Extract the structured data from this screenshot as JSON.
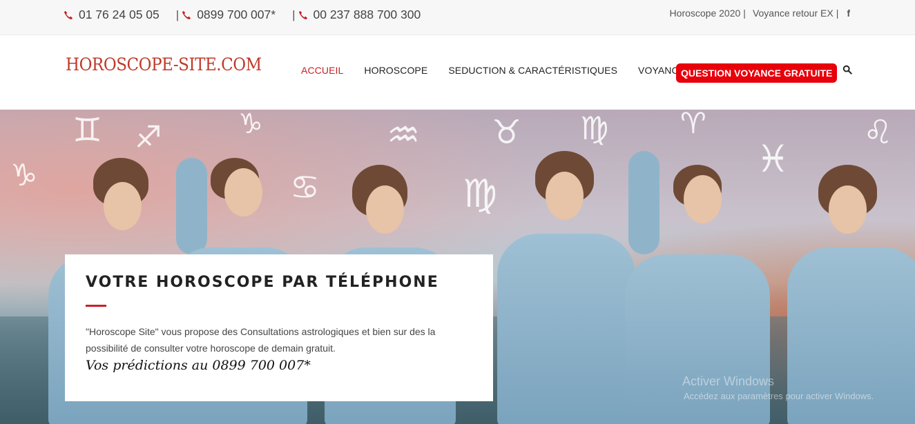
{
  "topbar": {
    "phones": [
      "01 76 24 05 05",
      "0899 700 007*",
      "00 237 888 700 300"
    ],
    "separator": "|",
    "links": [
      "Horoscope 2020",
      "Voyance retour EX"
    ],
    "facebook_glyph": "f"
  },
  "header": {
    "logo": "HOROSCOPE-SITE.COM",
    "nav": [
      {
        "label": "ACCUEIL",
        "active": true
      },
      {
        "label": "HOROSCOPE",
        "active": false
      },
      {
        "label": "SEDUCTION & CARACTÉRISTIQUES",
        "active": false
      },
      {
        "label": "VOYANCE",
        "active": false
      }
    ],
    "cta": "QUESTION VOYANCE GRATUITE",
    "search_icon": "search-icon"
  },
  "hero": {
    "title": "VOTRE HOROSCOPE PAR TÉLÉPHONE",
    "text": "\"Horoscope Site\" vous propose des Consultations astrologiques et bien sur des la possibilité de consulter votre horoscope de demain gratuit.",
    "script_line": "Vos prédictions au 0899 700 007*"
  },
  "watermark": {
    "line1": "Activer Windows",
    "line2": "Accédez aux paramètres pour activer Windows."
  },
  "colors": {
    "accent": "#c62026",
    "cta_bg": "#e8000b",
    "topbar_bg": "#f7f7f7"
  }
}
